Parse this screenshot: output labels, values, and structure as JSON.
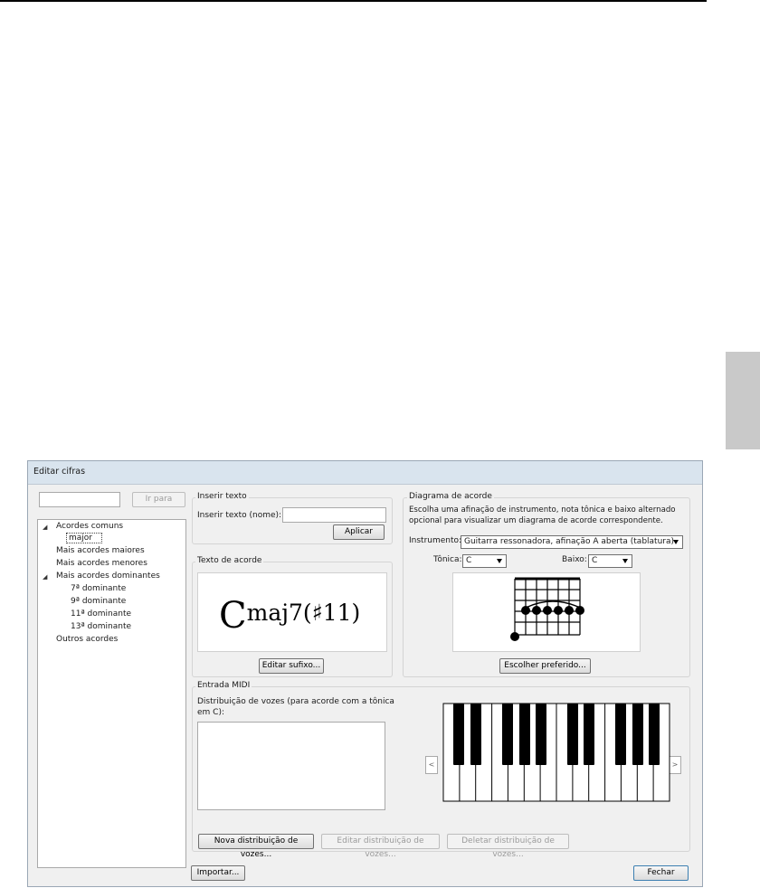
{
  "dialog": {
    "title": "Editar cifras",
    "search": {
      "value": "",
      "go_label": "Ir para"
    },
    "tree": {
      "groups": [
        {
          "label": "Acordes comuns",
          "expanded": true,
          "children": [
            "major"
          ]
        },
        {
          "label": "Mais acordes maiores"
        },
        {
          "label": "Mais acordes menores"
        },
        {
          "label": "Mais acordes dominantes",
          "expanded": true,
          "children": [
            "7ª dominante",
            "9ª dominante",
            "11ª dominante",
            "13ª dominante"
          ]
        },
        {
          "label": "Outros acordes"
        }
      ],
      "selected": "major"
    },
    "insert_text": {
      "group_label": "Inserir texto",
      "field_label": "Inserir texto (nome):",
      "field_value": "",
      "apply_label": "Aplicar"
    },
    "chord_text": {
      "group_label": "Texto de acorde",
      "root": "C",
      "suffix": "maj7(♯11)",
      "edit_suffix_label": "Editar sufixo..."
    },
    "chord_diagram": {
      "group_label": "Diagrama de acorde",
      "description": [
        "Escolha uma afinação de instrumento, nota tônica e baixo alternado",
        "opcional para visualizar um diagrama de acorde correspondente."
      ],
      "instrument_label": "Instrumento:",
      "instrument_value": "Guitarra ressonadora, afinação A aberta (tablatura)",
      "tonic_label": "Tônica:",
      "tonic_value": "C",
      "bass_label": "Baixo:",
      "bass_value": "C",
      "choose_preferred_label": "Escolher preferido..."
    },
    "midi": {
      "group_label": "Entrada MIDI",
      "voicing_label": [
        "Distribuição de vozes (para acorde com a tônica",
        "em C):"
      ],
      "new_label": "Nova distribuição de vozes...",
      "edit_label": "Editar distribuição de vozes...",
      "delete_label": "Deletar distribuição de vozes...",
      "prev_label": "<",
      "next_label": ">"
    },
    "import_label": "Importar...",
    "close_label": "Fechar"
  }
}
